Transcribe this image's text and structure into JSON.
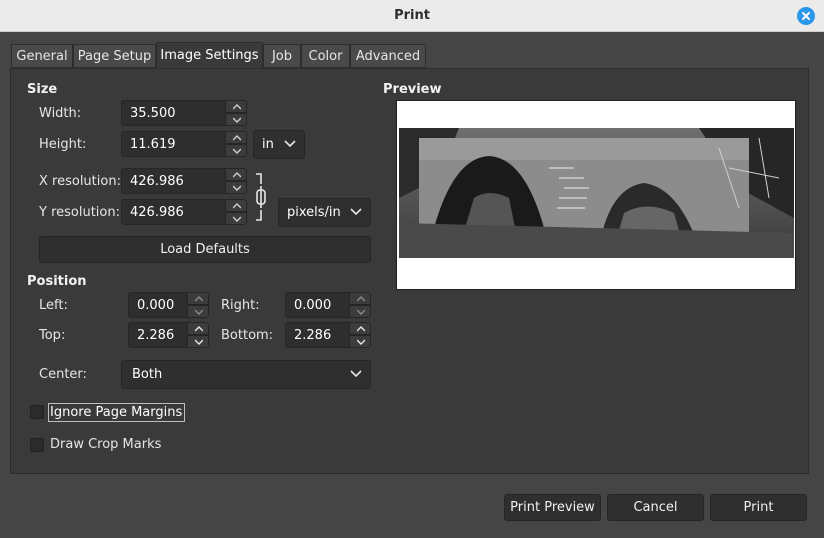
{
  "window": {
    "title": "Print"
  },
  "tabs": [
    "General",
    "Page Setup",
    "Image Settings",
    "Job",
    "Color",
    "Advanced"
  ],
  "size": {
    "heading": "Size",
    "width_label": "Width:",
    "width_value": "35.500",
    "height_label": "Height:",
    "height_value": "11.619",
    "unit": "in",
    "xres_label": "X resolution:",
    "xres_value": "426.986",
    "yres_label": "Y resolution:",
    "yres_value": "426.986",
    "res_unit": "pixels/in",
    "load_defaults": "Load Defaults"
  },
  "position": {
    "heading": "Position",
    "left_label": "Left:",
    "left_value": "0.000",
    "right_label": "Right:",
    "right_value": "0.000",
    "top_label": "Top:",
    "top_value": "2.286",
    "bottom_label": "Bottom:",
    "bottom_value": "2.286",
    "center_label": "Center:",
    "center_value": "Both"
  },
  "options": {
    "ignore_margins": "Ignore Page Margins",
    "crop_marks": "Draw Crop Marks"
  },
  "preview": {
    "heading": "Preview"
  },
  "buttons": {
    "print_preview": "Print Preview",
    "cancel": "Cancel",
    "print": "Print"
  },
  "colors": {
    "accent": "#2b97e8",
    "panel": "#3a3a3a",
    "background": "#454545"
  },
  "icons": {
    "close": "close-icon",
    "chain": "chain-link-icon",
    "dropdown": "chevron-down-icon"
  }
}
